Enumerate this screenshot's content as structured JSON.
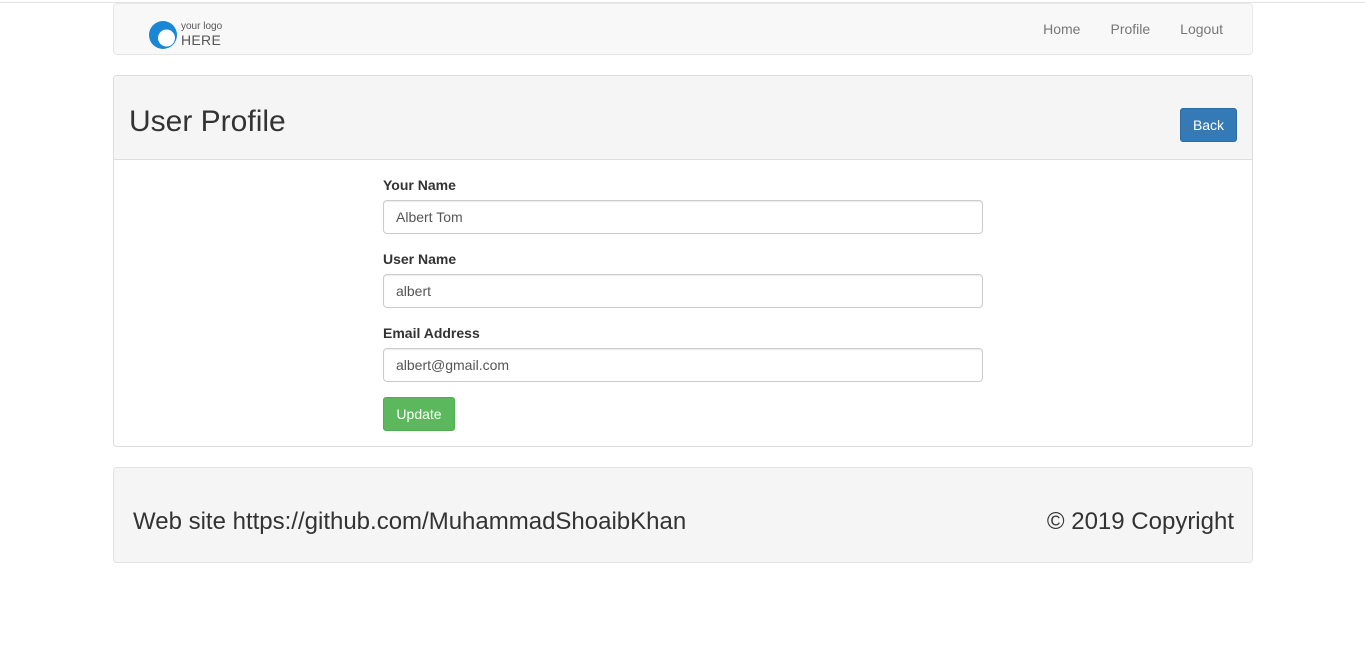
{
  "navbar": {
    "logo": {
      "small_text": "your logo",
      "big_text": "HERE",
      "icon": "logo-circle-icon",
      "colors": {
        "ring": "#1a86d6",
        "inner": "#ffffff"
      }
    },
    "links": [
      {
        "label": "Home"
      },
      {
        "label": "Profile"
      },
      {
        "label": "Logout"
      }
    ]
  },
  "panel": {
    "title": "User Profile",
    "back_label": "Back",
    "fields": [
      {
        "label": "Your Name",
        "value": "Albert Tom"
      },
      {
        "label": "User Name",
        "value": "albert"
      },
      {
        "label": "Email Address",
        "value": "albert@gmail.com"
      }
    ],
    "update_label": "Update"
  },
  "footer": {
    "left_text": "Web site https://github.com/MuhammadShoaibKhan",
    "right_text": "© 2019 Copyright"
  },
  "colors": {
    "primary": "#337ab7",
    "success": "#5cb85c"
  }
}
